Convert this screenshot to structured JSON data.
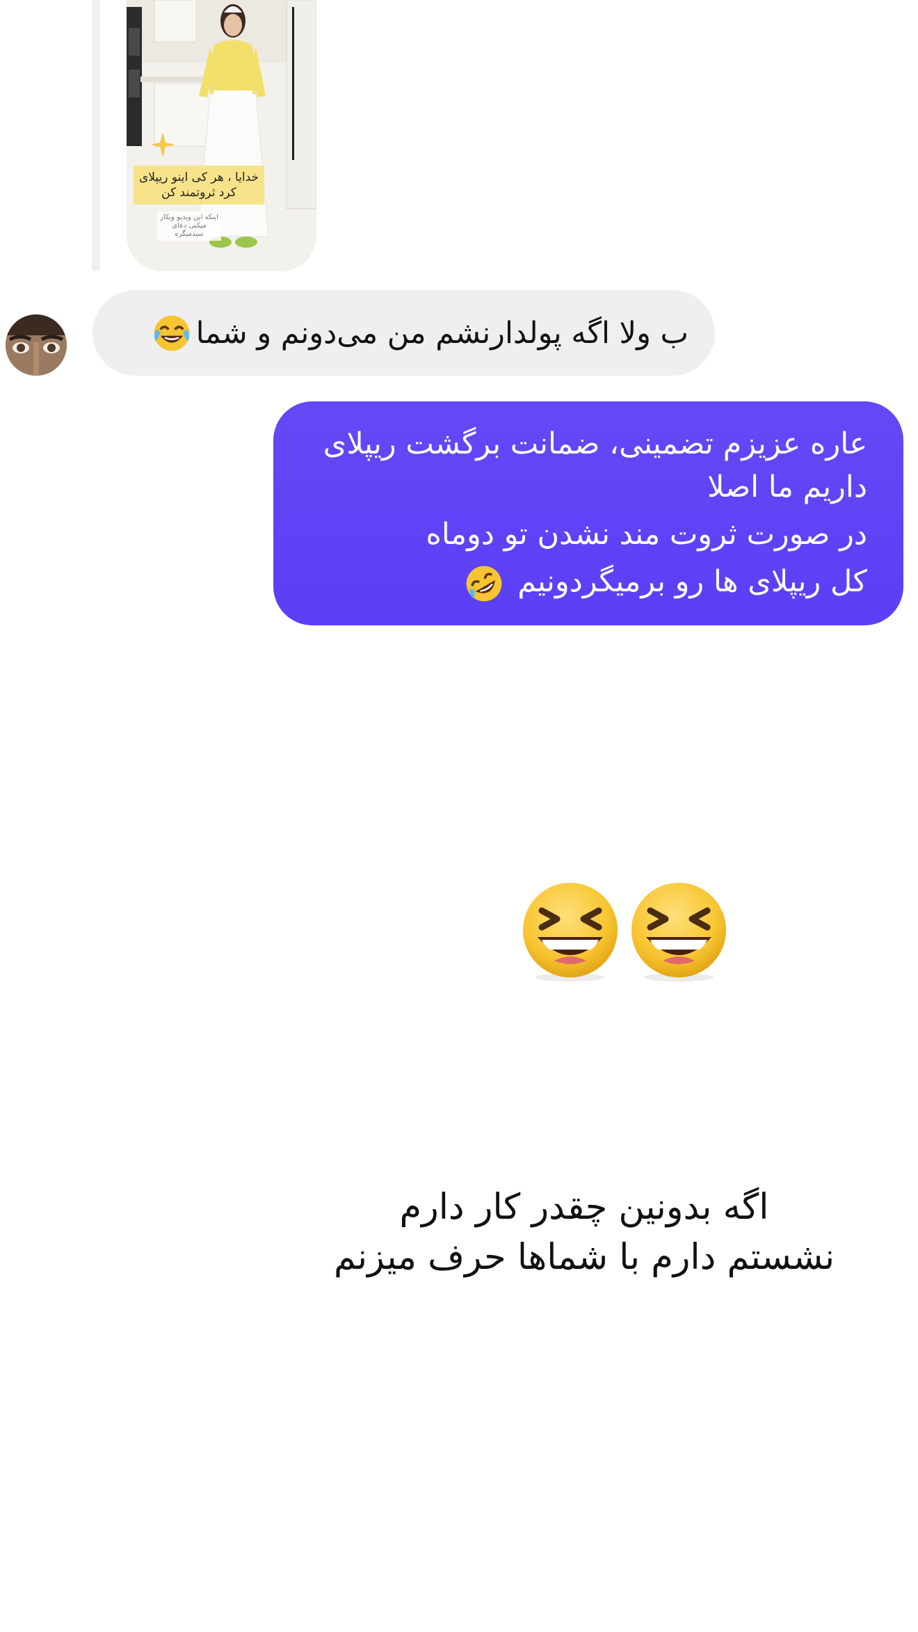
{
  "thread": {
    "story_reply": {
      "caption": "خدایا ، هر کی اینو ریپلای کرد ثروتمند کن",
      "subcaption": "اینکه این ویدیو ویکار میکنی دعای سیدمیگره"
    },
    "incoming": {
      "text": "ب ولا اگه پولدارنشم من می‌دونم و شما",
      "emoji": "face-with-tears-of-joy"
    },
    "outgoing": {
      "line1": "عاره عزیزم تضمینی، ضمانت برگشت ریپلای",
      "line2": "داریم ما اصلا",
      "line3": "در صورت ثروت مند نشدن تو دوماه",
      "line4": "کل ریپلای ها رو برمیگردونیم",
      "emoji": "rolling-on-the-floor-laughing"
    },
    "big_emoji": {
      "name": "grinning-squinting-face",
      "count": 2
    }
  },
  "story_text": {
    "line1": "اگه بدونین چقدر کار دارم",
    "line2": "نشستم دارم با شماها حرف میزنم"
  },
  "colors": {
    "outgoing_bubble": "#5b3ff6",
    "incoming_bubble": "#efeff1",
    "emoji_yellow": "#f7c531"
  }
}
